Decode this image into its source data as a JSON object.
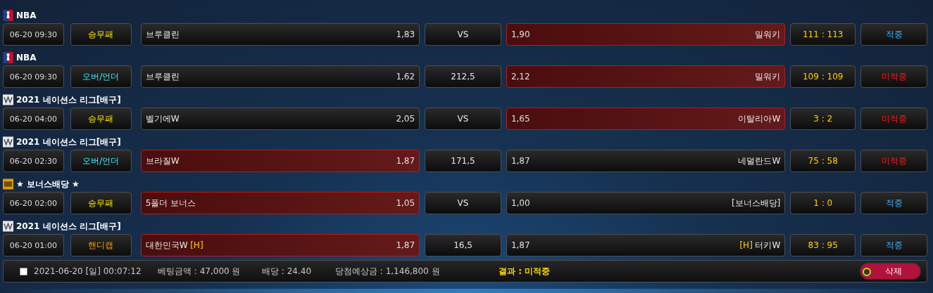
{
  "bets": [
    {
      "league": {
        "name": "NBA",
        "kind": "nba"
      },
      "time": "06-20 09:30",
      "bet_type": {
        "label": "승무패",
        "kind": "win_draw_lose"
      },
      "home": {
        "name": "브루클린",
        "odds": "1,83",
        "selected": false
      },
      "middle": "VS",
      "away": {
        "name": "밀워키",
        "odds": "1,90",
        "selected": true
      },
      "score": "111 : 113",
      "result": {
        "label": "적중",
        "kind": "hit"
      }
    },
    {
      "league": {
        "name": "NBA",
        "kind": "nba"
      },
      "time": "06-20 09:30",
      "bet_type": {
        "label": "오버/언더",
        "kind": "over_under"
      },
      "home": {
        "name": "브루클린",
        "odds": "1,62",
        "selected": false
      },
      "middle": "212,5",
      "away": {
        "name": "밀워키",
        "odds": "2,12",
        "selected": true
      },
      "score": "109 : 109",
      "result": {
        "label": "미적중",
        "kind": "miss"
      }
    },
    {
      "league": {
        "name": "2021 네이션스 리그[배구]",
        "kind": "vnl"
      },
      "time": "06-20 04:00",
      "bet_type": {
        "label": "승무패",
        "kind": "win_draw_lose"
      },
      "home": {
        "name": "벨기에W",
        "odds": "2,05",
        "selected": false
      },
      "middle": "VS",
      "away": {
        "name": "이탈리아W",
        "odds": "1,65",
        "selected": true
      },
      "score": "3 : 2",
      "result": {
        "label": "미적중",
        "kind": "miss"
      }
    },
    {
      "league": {
        "name": "2021 네이션스 리그[배구]",
        "kind": "vnl"
      },
      "time": "06-20 02:30",
      "bet_type": {
        "label": "오버/언더",
        "kind": "over_under"
      },
      "home": {
        "name": "브라질W",
        "odds": "1,87",
        "selected": true
      },
      "middle": "171,5",
      "away": {
        "name": "네덜란드W",
        "odds": "1,87",
        "selected": false
      },
      "score": "75 : 58",
      "result": {
        "label": "미적중",
        "kind": "miss"
      }
    },
    {
      "league": {
        "name": "★ 보너스배당 ★",
        "kind": "bonus"
      },
      "time": "06-20 02:00",
      "bet_type": {
        "label": "승무패",
        "kind": "win_draw_lose"
      },
      "home": {
        "name": "5폴더 보너스",
        "odds": "1,05",
        "selected": true
      },
      "middle": "VS",
      "away": {
        "name": "[보너스배당]",
        "odds": "1,00",
        "selected": false
      },
      "score": "1 : 0",
      "result": {
        "label": "적중",
        "kind": "hit"
      }
    },
    {
      "league": {
        "name": "2021 네이션스 리그[배구]",
        "kind": "vnl"
      },
      "time": "06-20 01:00",
      "bet_type": {
        "label": "핸디캡",
        "kind": "handicap"
      },
      "home": {
        "name": "대한민국W",
        "tag": "[H]",
        "odds": "1,87",
        "selected": true
      },
      "middle": "16,5",
      "away": {
        "name": "터키W",
        "tag": "[H]",
        "odds": "1,87",
        "selected": false
      },
      "score": "83 : 95",
      "result": {
        "label": "적중",
        "kind": "hit"
      }
    }
  ],
  "summary": {
    "checked": false,
    "datetime": "2021-06-20 [일] 00:07:12",
    "bet_amount": "베팅금액 : 47,000 원",
    "odds": "배당 : 24.40",
    "expected_win": "당첨예상금 : 1,146,800 원",
    "result": "결과 : 미적중",
    "delete_button": "삭제"
  }
}
